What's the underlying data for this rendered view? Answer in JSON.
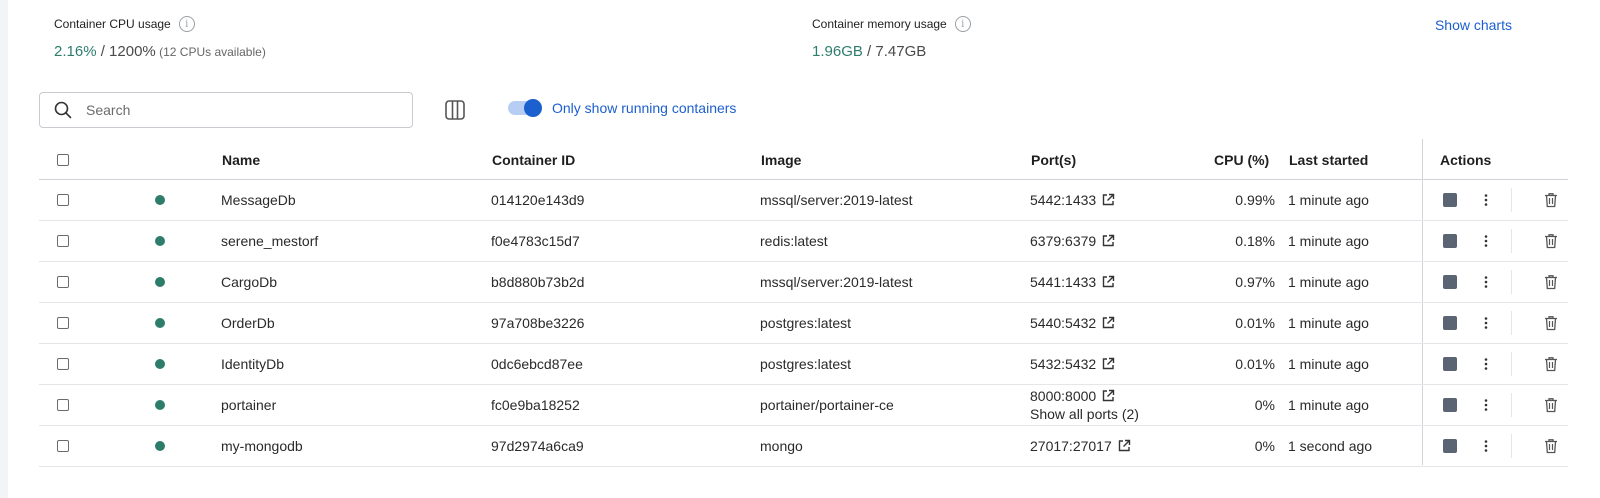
{
  "stats": {
    "cpu_label": "Container CPU usage",
    "cpu_used": "2.16%",
    "cpu_total": " / 1200%",
    "cpu_note": " (12 CPUs available)",
    "mem_label": "Container memory usage",
    "mem_used": "1.96GB",
    "mem_total": " / 7.47GB",
    "info_glyph": "i",
    "show_charts": "Show charts"
  },
  "toolbar": {
    "search_placeholder": "Search",
    "toggle_label": "Only show running containers",
    "toggle_on": true
  },
  "table": {
    "headers": {
      "name": "Name",
      "container_id": "Container ID",
      "image": "Image",
      "ports": "Port(s)",
      "cpu": "CPU (%)",
      "last_started": "Last started",
      "actions": "Actions"
    },
    "rows": [
      {
        "name": "MessageDb",
        "id": "014120e143d9",
        "image": "mssql/server:2019-latest",
        "port": "5442:1433",
        "cpu": "0.99%",
        "started": "1 minute ago"
      },
      {
        "name": "serene_mestorf",
        "id": "f0e4783c15d7",
        "image": "redis:latest",
        "port": "6379:6379",
        "cpu": "0.18%",
        "started": "1 minute ago"
      },
      {
        "name": "CargoDb",
        "id": "b8d880b73b2d",
        "image": "mssql/server:2019-latest",
        "port": "5441:1433",
        "cpu": "0.97%",
        "started": "1 minute ago"
      },
      {
        "name": "OrderDb",
        "id": "97a708be3226",
        "image": "postgres:latest",
        "port": "5440:5432",
        "cpu": "0.01%",
        "started": "1 minute ago"
      },
      {
        "name": "IdentityDb",
        "id": "0dc6ebcd87ee",
        "image": "postgres:latest",
        "port": "5432:5432",
        "cpu": "0.01%",
        "started": "1 minute ago"
      },
      {
        "name": "portainer",
        "id": "fc0e9ba18252",
        "image": "portainer/portainer-ce",
        "port": "8000:8000",
        "port_extra": "Show all ports (2)",
        "cpu": "0%",
        "started": "1 minute ago"
      },
      {
        "name": "my-mongodb",
        "id": "97d2974a6ca9",
        "image": "mongo",
        "port": "27017:27017",
        "cpu": "0%",
        "started": "1 second ago"
      }
    ]
  },
  "colors": {
    "accent_green": "#2e7d6b",
    "link_blue": "#1c5fcf",
    "status_running": "#2e7d6b"
  }
}
